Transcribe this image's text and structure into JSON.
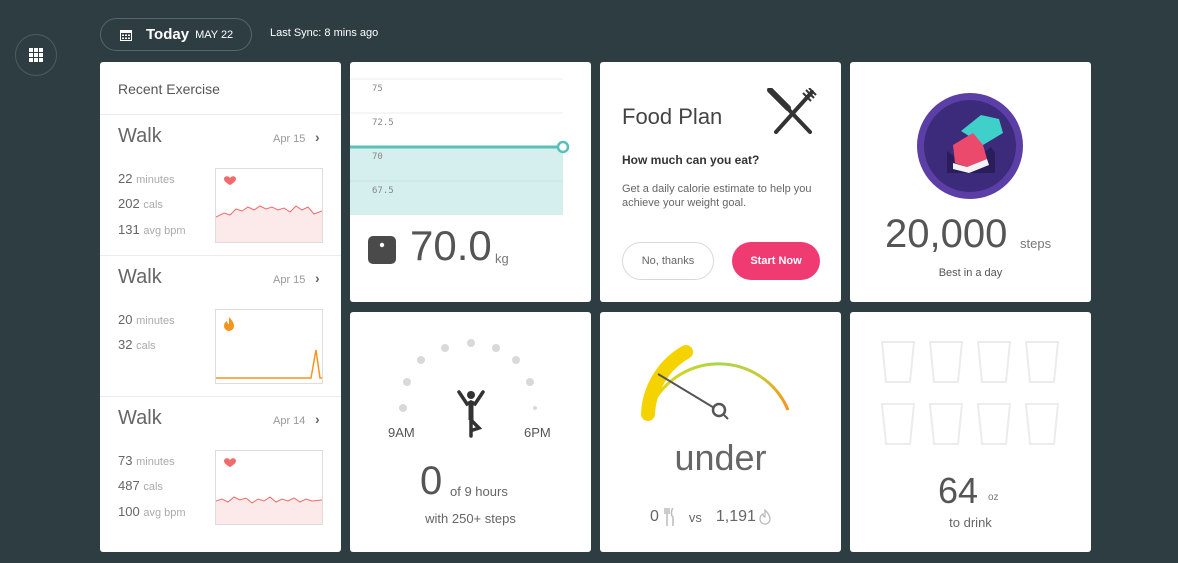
{
  "header": {
    "today_label": "Today",
    "today_date": "MAY 22",
    "sync": "Last Sync: 8 mins ago"
  },
  "exercise": {
    "title": "Recent Exercise",
    "items": [
      {
        "name": "Walk",
        "date": "Apr 15",
        "minutes": "22",
        "minutes_unit": "minutes",
        "cals": "202",
        "cals_unit": "cals",
        "bpm": "131",
        "bpm_unit": "avg bpm",
        "icon": "heart-icon"
      },
      {
        "name": "Walk",
        "date": "Apr 15",
        "minutes": "20",
        "minutes_unit": "minutes",
        "cals": "32",
        "cals_unit": "cals",
        "icon": "flame-icon"
      },
      {
        "name": "Walk",
        "date": "Apr 14",
        "minutes": "73",
        "minutes_unit": "minutes",
        "cals": "487",
        "cals_unit": "cals",
        "bpm": "100",
        "bpm_unit": "avg bpm",
        "icon": "heart-icon"
      }
    ]
  },
  "weight": {
    "ticks": [
      "75",
      "72.5",
      "70",
      "67.5"
    ],
    "value": "70.0",
    "unit": "kg"
  },
  "food_plan": {
    "title": "Food Plan",
    "question": "How much can you eat?",
    "description": "Get a daily calorie estimate to help you achieve your weight goal.",
    "no_button": "No, thanks",
    "start_button": "Start Now"
  },
  "steps_badge": {
    "value": "20,000",
    "unit": "steps",
    "label": "Best in a day"
  },
  "hourly": {
    "start": "9AM",
    "end": "6PM",
    "value": "0",
    "of": "of 9 hours",
    "sub": "with 250+ steps"
  },
  "calories": {
    "status": "under",
    "eaten": "0",
    "vs": "vs",
    "burned": "1,191"
  },
  "water": {
    "value": "64",
    "unit": "oz",
    "label": "to drink",
    "glasses": 8
  },
  "colors": {
    "background": "#2e3d41",
    "teal": "#58bfbb",
    "pink": "#ef3b72",
    "heart": "#f06b6b",
    "flame": "#f7941d",
    "badge_purple": "#5c3fa6"
  }
}
